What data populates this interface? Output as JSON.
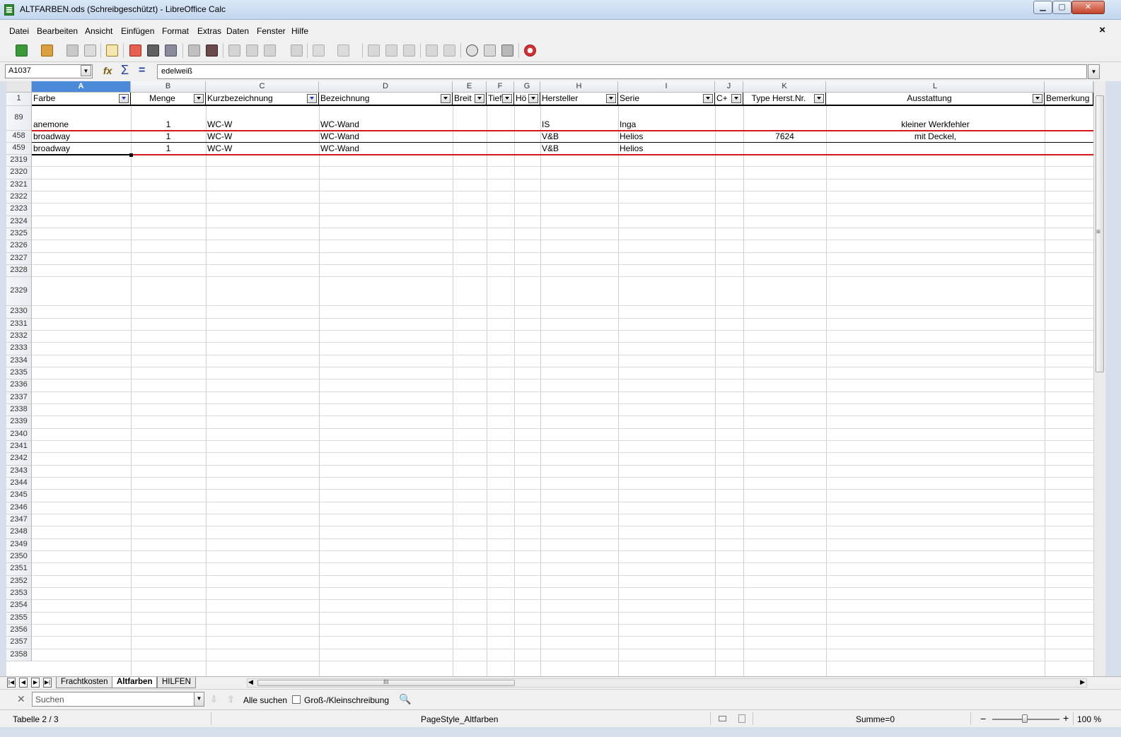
{
  "window": {
    "title": "ALTFARBEN.ods (Schreibgeschützt) - LibreOffice Calc",
    "min": "▁",
    "max": "▢",
    "close": "✕"
  },
  "menu": [
    "Datei",
    "Bearbeiten",
    "Ansicht",
    "Einfügen",
    "Format",
    "Extras",
    "Daten",
    "Fenster",
    "Hilfe"
  ],
  "doc_close": "×",
  "formula_bar": {
    "name_box": "A1037",
    "formula": "edelweiß",
    "fx": "fx",
    "sum": "Σ",
    "eq": "="
  },
  "columns": [
    "A",
    "B",
    "C",
    "D",
    "E",
    "F",
    "G",
    "H",
    "I",
    "J",
    "K",
    "L"
  ],
  "selected_column": "A",
  "header_row": {
    "row_number": "1",
    "cells": [
      "Farbe",
      "Menge",
      "Kurzbezeichnung",
      "Bezeichnung",
      "Breit",
      "Tief",
      "Hö",
      "Hersteller",
      "Serie",
      "C+",
      "Type Herst.Nr.",
      "Ausstattung",
      "Bemerkung"
    ]
  },
  "data_rows": [
    {
      "row_number": "89",
      "cells": [
        "anemone",
        "1",
        "WC-W",
        "WC-Wand",
        "",
        "",
        "",
        "IS",
        "Inga",
        "",
        "",
        "kleiner Werkfehler",
        ""
      ]
    },
    {
      "row_number": "458",
      "cells": [
        "broadway",
        "1",
        "WC-W",
        "WC-Wand",
        "",
        "",
        "",
        "V&B",
        "Helios",
        "",
        "7624",
        "mit Deckel,",
        ""
      ]
    },
    {
      "row_number": "459",
      "cells": [
        "broadway",
        "1",
        "WC-W",
        "WC-Wand",
        "",
        "",
        "",
        "V&B",
        "Helios",
        "",
        "",
        "",
        ""
      ]
    }
  ],
  "empty_rows": [
    "2319",
    "2320",
    "2321",
    "2322",
    "2323",
    "2324",
    "2325",
    "2326",
    "2327",
    "2328",
    "2329",
    "2330",
    "2331",
    "2332",
    "2333",
    "2334",
    "2335",
    "2336",
    "2337",
    "2338",
    "2339",
    "2340",
    "2341",
    "2342",
    "2343",
    "2344",
    "2345",
    "2346",
    "2347",
    "2348",
    "2349",
    "2350",
    "2351",
    "2352",
    "2353",
    "2354",
    "2355",
    "2356",
    "2357",
    "2358"
  ],
  "sheet_tabs": [
    {
      "label": "Frachtkosten",
      "active": false
    },
    {
      "label": "Altfarben",
      "active": true
    },
    {
      "label": "HILFEN",
      "active": false
    }
  ],
  "hscroll_grip": "III",
  "vscroll_grip": "≡",
  "find_bar": {
    "placeholder": "Suchen",
    "find_all": "Alle suchen",
    "match_case": "Groß-/Kleinschreibung"
  },
  "status_bar": {
    "sheet": "Tabelle 2 / 3",
    "page_style": "PageStyle_Altfarben",
    "sum": "Summe=0",
    "zoom_minus": "−",
    "zoom_plus": "+",
    "zoom": "100 %"
  },
  "colors": {
    "accent": "#4a8ad8",
    "filter_line": "#d81818"
  }
}
